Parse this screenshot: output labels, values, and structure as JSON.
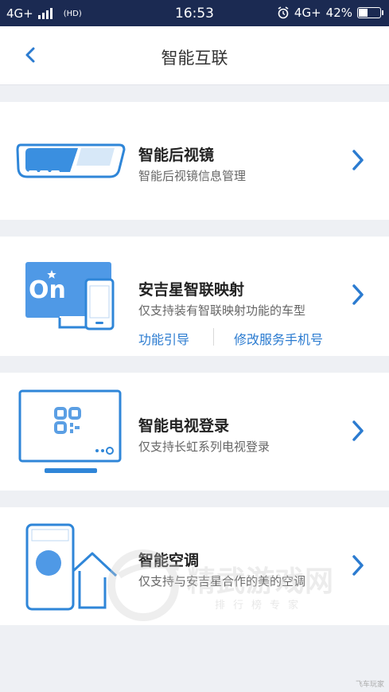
{
  "statusbar": {
    "network": "4G+",
    "hd": "(HD)",
    "time": "16:53",
    "network_right": "4G+",
    "battery_text": "42%",
    "battery_level": 0.42
  },
  "navbar": {
    "title": "智能互联"
  },
  "items": [
    {
      "title": "智能后视镜",
      "subtitle": "智能后视镜信息管理"
    },
    {
      "title": "安吉星智联映射",
      "subtitle": "仅支持装有智联映射功能的车型",
      "link_left": "功能引导",
      "link_right": "修改服务手机号",
      "icon_text": "On"
    },
    {
      "title": "智能电视登录",
      "subtitle": "仅支持长虹系列电视登录"
    },
    {
      "title": "智能空调",
      "subtitle": "仅支持与安吉星合作的美的空调"
    }
  ],
  "watermark": {
    "text": "精武游戏网",
    "sub": "排行榜专家"
  },
  "corner_text": "飞车玩家",
  "colors": {
    "accent": "#2b7bd0",
    "icon_blue": "#2f86d8",
    "statusbar": "#1b2a52"
  }
}
